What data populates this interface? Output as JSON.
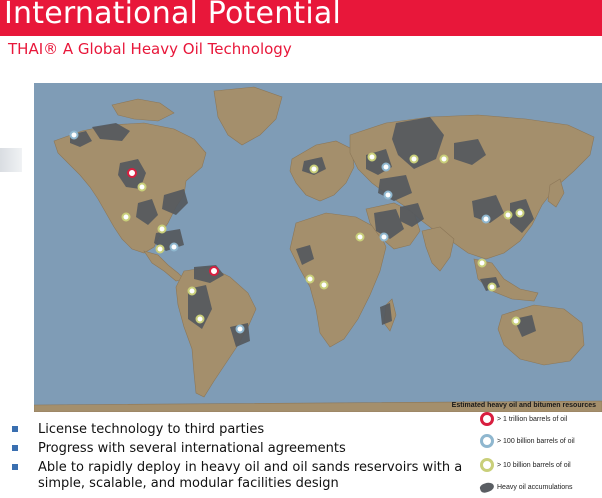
{
  "header": {
    "title": "International Potential",
    "subtitle": "THAI® A Global Heavy Oil Technology"
  },
  "map": {
    "caption": "Estimated heavy oil and bitumen resources",
    "colors": {
      "ocean": "#7f9cb6",
      "land": "#a48f6c",
      "accumulation": "#55595e",
      "ring_trillion": "#d81e3f",
      "ring_100b": "#8fb7cf",
      "ring_10b": "#c9cf7a"
    }
  },
  "bullets": [
    "License technology to third parties",
    "Progress with several international agreements",
    "Able to rapidly deploy in heavy oil and oil sands reservoirs with a simple, scalable, and modular facilities design"
  ],
  "legend": [
    {
      "icon": "red-ring-icon",
      "label": "> 1 trillion barrels of oil",
      "color": "#d81e3f"
    },
    {
      "icon": "blue-ring-icon",
      "label": "> 100 billion barrels of oil",
      "color": "#8fb7cf"
    },
    {
      "icon": "yellow-ring-icon",
      "label": "> 10 billion barrels of oil",
      "color": "#c9cf7a"
    },
    {
      "icon": "accumulation-blob-icon",
      "label": "Heavy oil accumulations",
      "color": "#5a5e63"
    }
  ]
}
